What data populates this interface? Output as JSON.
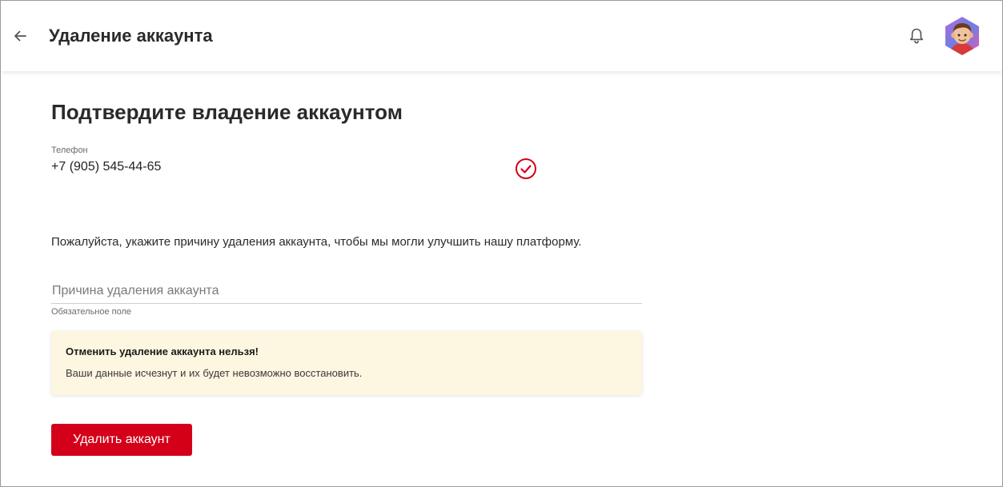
{
  "header": {
    "title": "Удаление аккаунта",
    "back_icon": "arrow-left-icon",
    "notification_icon": "bell-icon",
    "avatar_icon": "user-avatar"
  },
  "main": {
    "heading": "Подтвердите владение аккаунтом",
    "phone": {
      "label": "Телефон",
      "value": "+7 (905) 545-44-65",
      "status_icon": "check-circle-icon"
    },
    "reason_prompt": "Пожалуйста, укажите причину удаления аккаунта, чтобы мы могли улучшить нашу платформу.",
    "reason_field": {
      "placeholder": "Причина удаления аккаунта",
      "value": "",
      "helper": "Обязательное поле"
    },
    "warning": {
      "title": "Отменить удаление аккаунта нельзя!",
      "text": "Ваши данные исчезнут и их будет невозможно восстановить."
    },
    "delete_button_label": "Удалить аккаунт"
  },
  "colors": {
    "accent": "#d4001a",
    "warning_background": "#fdf6e1"
  }
}
